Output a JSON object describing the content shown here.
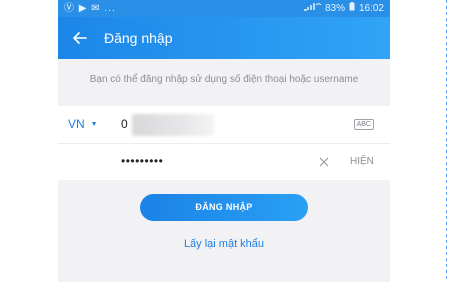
{
  "status_bar": {
    "left_icons": "Ⓥ ▶ ✉ ...",
    "battery": "83%",
    "time": "16:02"
  },
  "app_bar": {
    "title": "Đăng nhập"
  },
  "hint": "Bạn có thể đăng nhập sử dụng số điện thoại hoặc username",
  "form": {
    "country_code": "VN",
    "phone_value": "0",
    "keyboard_badge": "ABC",
    "password_value": "•••••••••",
    "show_label": "HIỆN"
  },
  "login_button": "ĐĂNG NHẬP",
  "forgot_link": "Lấy lại mật khẩu",
  "colors": {
    "accent": "#1f7fe0",
    "appbar": "#1c86e8",
    "background": "#f2f2f4"
  }
}
